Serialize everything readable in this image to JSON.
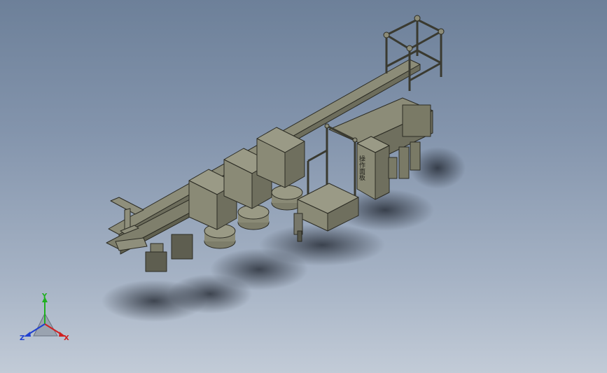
{
  "viewport": {
    "background_top": "#6d8099",
    "background_bottom": "#c2cbd7",
    "model_color": "#8f8f7c",
    "model_shade": "#6d6d5c",
    "model_edge": "#2c2c24"
  },
  "triad": {
    "x_label": "X",
    "y_label": "Y",
    "z_label": "Z",
    "x_color": "#d02020",
    "y_color": "#20b020",
    "z_color": "#2040d0"
  },
  "model": {
    "panel_text": "操作面板"
  }
}
